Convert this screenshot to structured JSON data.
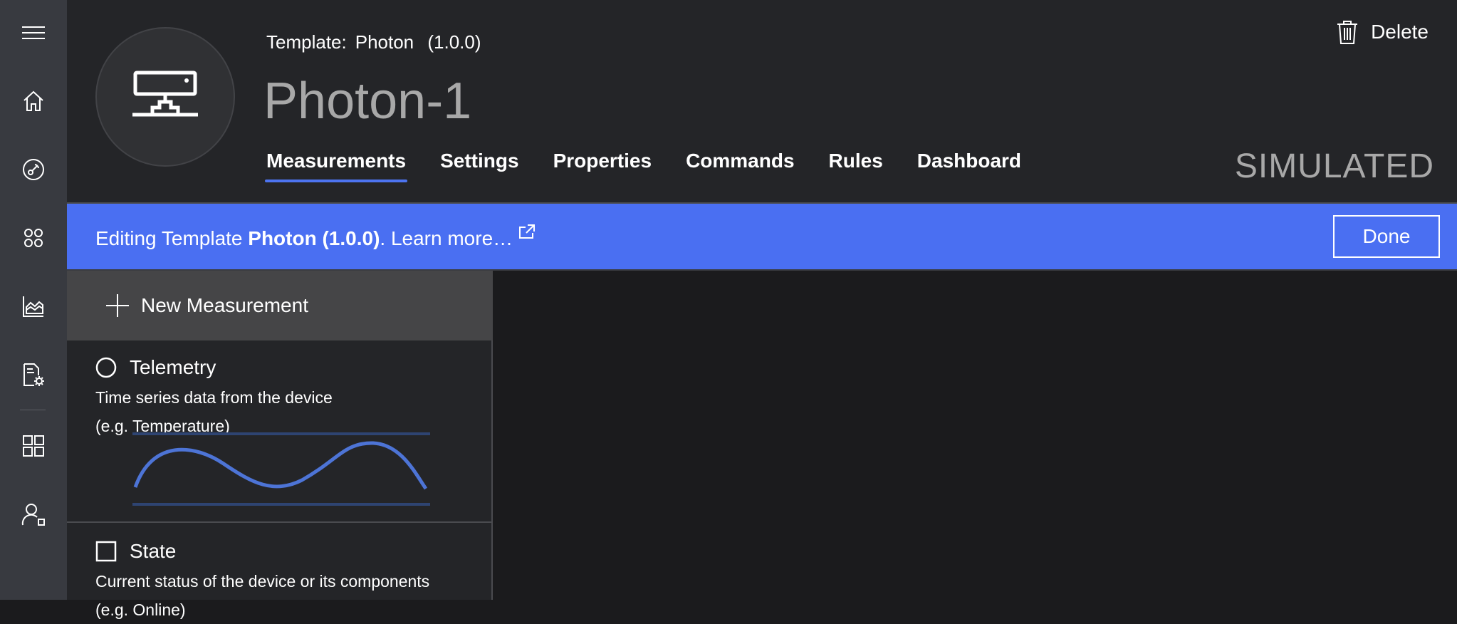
{
  "header": {
    "template_label": "Template:",
    "template_name": "Photon",
    "template_version": "(1.0.0)",
    "device_name": "Photon-1",
    "delete_label": "Delete",
    "status": "SIMULATED",
    "tabs": [
      {
        "label": "Measurements",
        "active": true
      },
      {
        "label": "Settings"
      },
      {
        "label": "Properties"
      },
      {
        "label": "Commands"
      },
      {
        "label": "Rules"
      },
      {
        "label": "Dashboard"
      }
    ]
  },
  "banner": {
    "prefix": "Editing Template ",
    "template": "Photon (1.0.0)",
    "suffix": ". Learn more…",
    "done_label": "Done"
  },
  "panel": {
    "new_measurement_label": "New Measurement",
    "cards": [
      {
        "title": "Telemetry",
        "desc_line1": "Time series data from the device",
        "desc_line2": "(e.g. Temperature)"
      },
      {
        "title": "State",
        "desc_line1": "Current status of the device or its components",
        "desc_line2": "(e.g. Online)"
      }
    ]
  },
  "nav": {
    "icons": [
      "menu-icon",
      "home-icon",
      "device-explorer-icon",
      "device-sets-icon",
      "analytics-icon",
      "jobs-icon",
      "app-builder-icon",
      "administration-icon"
    ]
  },
  "colors": {
    "accent": "#4a6ff2",
    "header_bg": "#242528",
    "rail_bg": "#383a40",
    "wave": "#4d74d6"
  }
}
